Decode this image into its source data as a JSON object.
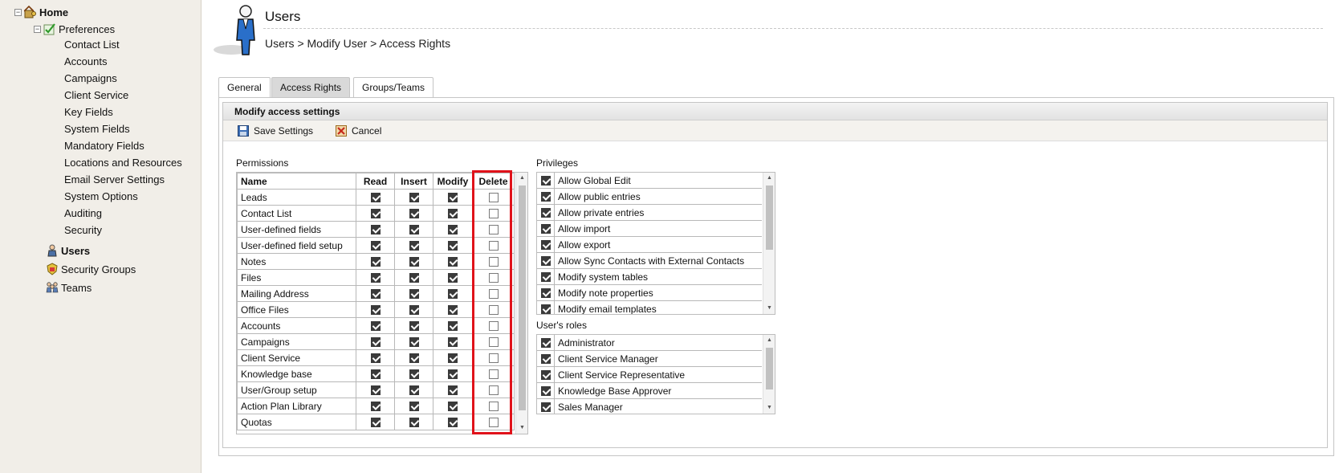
{
  "sidebar": {
    "home_label": "Home",
    "preferences_label": "Preferences",
    "collapse_glyph": "−",
    "preference_items": [
      "Contact List",
      "Accounts",
      "Campaigns",
      "Client Service",
      "Key Fields",
      "System Fields",
      "Mandatory Fields",
      "Locations and Resources",
      "Email Server Settings",
      "System Options",
      "Auditing",
      "Security"
    ],
    "users_label": "Users",
    "security_groups_label": "Security Groups",
    "teams_label": "Teams"
  },
  "header": {
    "title": "Users",
    "breadcrumb": "Users > Modify User > Access Rights"
  },
  "tabs": [
    "General",
    "Access Rights",
    "Groups/Teams"
  ],
  "active_tab": "Access Rights",
  "panel": {
    "title": "Modify access settings",
    "save_label": "Save Settings",
    "cancel_label": "Cancel"
  },
  "permissions": {
    "label": "Permissions",
    "columns": [
      "Name",
      "Read",
      "Insert",
      "Modify",
      "Delete"
    ],
    "rows": [
      {
        "name": "Leads",
        "read": true,
        "insert": true,
        "modify": true,
        "delete": false
      },
      {
        "name": "Contact List",
        "read": true,
        "insert": true,
        "modify": true,
        "delete": false
      },
      {
        "name": "User-defined fields",
        "read": true,
        "insert": true,
        "modify": true,
        "delete": false
      },
      {
        "name": "User-defined field setup",
        "read": true,
        "insert": true,
        "modify": true,
        "delete": false
      },
      {
        "name": "Notes",
        "read": true,
        "insert": true,
        "modify": true,
        "delete": false
      },
      {
        "name": "Files",
        "read": true,
        "insert": true,
        "modify": true,
        "delete": false
      },
      {
        "name": "Mailing Address",
        "read": true,
        "insert": true,
        "modify": true,
        "delete": false
      },
      {
        "name": "Office Files",
        "read": true,
        "insert": true,
        "modify": true,
        "delete": false
      },
      {
        "name": "Accounts",
        "read": true,
        "insert": true,
        "modify": true,
        "delete": false
      },
      {
        "name": "Campaigns",
        "read": true,
        "insert": true,
        "modify": true,
        "delete": false
      },
      {
        "name": "Client Service",
        "read": true,
        "insert": true,
        "modify": true,
        "delete": false
      },
      {
        "name": "Knowledge base",
        "read": true,
        "insert": true,
        "modify": true,
        "delete": false
      },
      {
        "name": "User/Group setup",
        "read": true,
        "insert": true,
        "modify": true,
        "delete": false
      },
      {
        "name": "Action Plan Library",
        "read": true,
        "insert": true,
        "modify": true,
        "delete": false
      },
      {
        "name": "Quotas",
        "read": true,
        "insert": true,
        "modify": true,
        "delete": false
      }
    ]
  },
  "privileges": {
    "label": "Privileges",
    "items": [
      {
        "label": "Allow Global Edit",
        "checked": true
      },
      {
        "label": "Allow public entries",
        "checked": true
      },
      {
        "label": "Allow private entries",
        "checked": true
      },
      {
        "label": "Allow import",
        "checked": true
      },
      {
        "label": "Allow export",
        "checked": true
      },
      {
        "label": "Allow Sync Contacts with External Contacts",
        "checked": true
      },
      {
        "label": "Modify system tables",
        "checked": true
      },
      {
        "label": "Modify note properties",
        "checked": true
      },
      {
        "label": "Modify email templates",
        "checked": true
      }
    ]
  },
  "roles": {
    "label": "User's roles",
    "items": [
      {
        "label": "Administrator",
        "checked": true
      },
      {
        "label": "Client Service Manager",
        "checked": true
      },
      {
        "label": "Client Service Representative",
        "checked": true
      },
      {
        "label": "Knowledge Base Approver",
        "checked": true
      },
      {
        "label": "Sales Manager",
        "checked": true
      }
    ]
  },
  "colors": {
    "highlight": "#e0121a",
    "sidebar_bg": "#f1eee8",
    "active_tab_bg": "#d9d9d9"
  },
  "icons": {
    "scroll_up": "▲",
    "scroll_down": "▼"
  }
}
